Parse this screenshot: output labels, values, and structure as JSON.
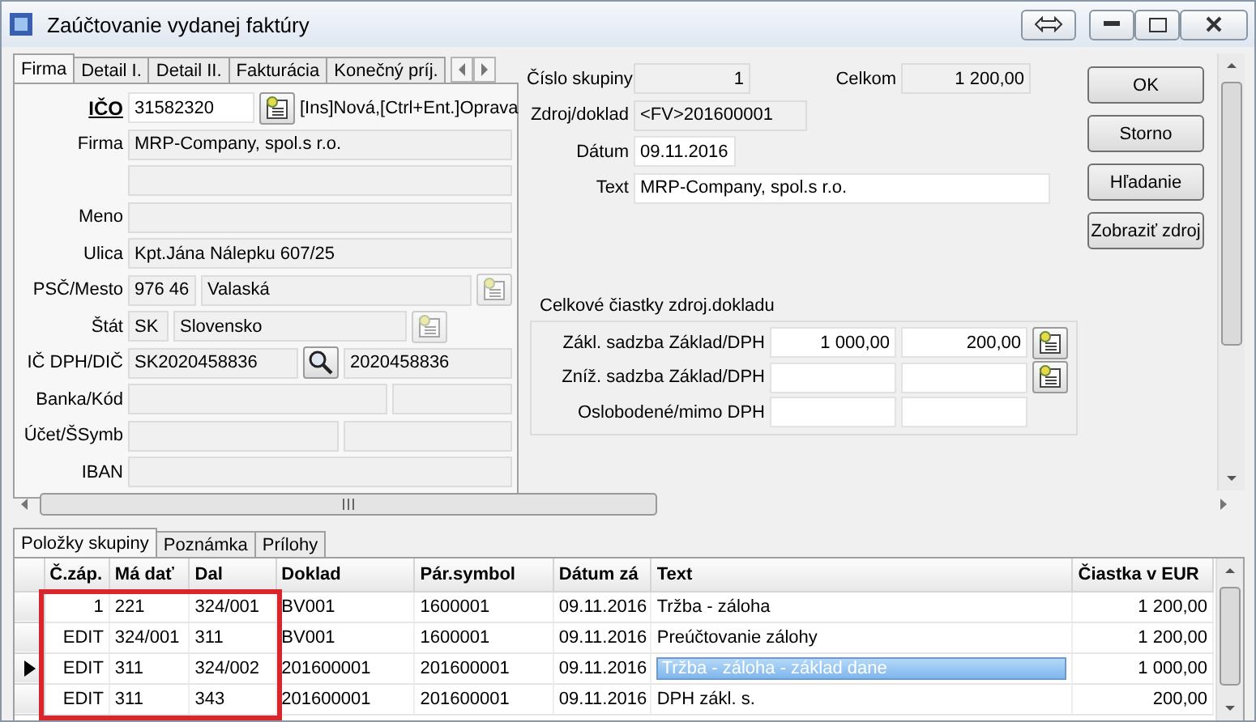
{
  "window": {
    "title": "Zaúčtovanie vydanej faktúry"
  },
  "form_tabs": [
    {
      "label": "Firma",
      "selected": true
    },
    {
      "label": "Detail I.",
      "selected": false
    },
    {
      "label": "Detail II.",
      "selected": false
    },
    {
      "label": "Fakturácia",
      "selected": false
    },
    {
      "label": "Konečný príj.",
      "selected": false
    }
  ],
  "company_rows": [
    {
      "label": "IČO",
      "items": [
        {
          "kind": "field",
          "value": "31582320",
          "editable": true
        },
        {
          "kind": "card-button",
          "disabled": false
        },
        {
          "kind": "hint",
          "text": "[Ins]Nová,[Ctrl+Ent.]Oprava"
        }
      ]
    },
    {
      "label": "Firma",
      "items": [
        {
          "kind": "field",
          "value": "MRP-Company, spol.s r.o.",
          "editable": false
        }
      ]
    },
    {
      "items": [
        {
          "kind": "field",
          "editable": false
        }
      ]
    },
    {
      "label": "Meno",
      "items": [
        {
          "kind": "field",
          "editable": false
        }
      ]
    },
    {
      "label": "Ulica",
      "items": [
        {
          "kind": "field",
          "value": "Kpt.Jána Nálepku 607/25",
          "editable": false
        }
      ]
    },
    {
      "label": "PSČ/Mesto",
      "items": [
        {
          "kind": "field",
          "value": "976 46",
          "editable": false
        },
        {
          "kind": "field",
          "value": "Valaská",
          "editable": false
        },
        {
          "kind": "card-button",
          "disabled": true
        }
      ]
    },
    {
      "label": "Štát",
      "items": [
        {
          "kind": "field",
          "value": "SK",
          "editable": false
        },
        {
          "kind": "field",
          "value": "Slovensko",
          "editable": false
        },
        {
          "kind": "card-button",
          "disabled": true
        }
      ]
    },
    {
      "label": "IČ DPH/DIČ",
      "items": [
        {
          "kind": "field",
          "value": "SK2020458836",
          "editable": false
        },
        {
          "kind": "search-button"
        },
        {
          "kind": "field",
          "value": "2020458836",
          "editable": false
        }
      ]
    },
    {
      "label": "Banka/Kód",
      "items": [
        {
          "kind": "field",
          "editable": false
        },
        {
          "kind": "field",
          "editable": false
        }
      ]
    },
    {
      "label": "Účet/ŠSymb",
      "items": [
        {
          "kind": "field",
          "editable": false
        },
        {
          "kind": "field",
          "editable": false
        }
      ]
    },
    {
      "label": "IBAN",
      "items": [
        {
          "kind": "field",
          "editable": false
        }
      ]
    }
  ],
  "header_fields": [
    {
      "label": "Číslo skupiny",
      "value": "1",
      "editable": false
    },
    {
      "label": "Celkom",
      "value": "1 200,00",
      "editable": false
    },
    {
      "label": "Zdroj/doklad",
      "value": "<FV>201600001",
      "editable": false
    },
    {
      "label": "Dátum",
      "value": "09.11.2016",
      "editable": true
    },
    {
      "label": "Text",
      "value": "MRP-Company, spol.s r.o.",
      "editable": true
    }
  ],
  "buttons": [
    "OK",
    "Storno",
    "Hľadanie",
    "Zobraziť zdroj"
  ],
  "totals": {
    "title": "Celkové čiastky zdroj.dokladu",
    "rows": [
      {
        "label": "Zákl. sadzba Základ/DPH",
        "base": "1 000,00",
        "vat": "200,00",
        "has_button": true
      },
      {
        "label": "Zníž. sadzba Základ/DPH",
        "has_button": true
      },
      {
        "label": "Oslobodené/mimo DPH",
        "has_button": false
      }
    ]
  },
  "bottom_tabs": [
    {
      "label": "Položky skupiny",
      "selected": true
    },
    {
      "label": "Poznámka",
      "selected": false
    },
    {
      "label": "Prílohy",
      "selected": false
    }
  ],
  "table": {
    "annotation_frame": true,
    "columns": [
      {
        "label": "Č.záp."
      },
      {
        "label": "Má dať"
      },
      {
        "label": "Dal"
      },
      {
        "label": "Doklad"
      },
      {
        "label": "Pár.symbol"
      },
      {
        "label": "Dátum zá"
      },
      {
        "label": "Text"
      },
      {
        "label": "Čiastka v EUR"
      }
    ],
    "rows": [
      {
        "selected": false,
        "cells": [
          "1",
          "221",
          "324/001",
          "BV001",
          "1600001",
          "09.11.2016",
          "Tržba - záloha",
          "1 200,00"
        ]
      },
      {
        "selected": false,
        "cells": [
          "EDIT",
          "324/001",
          "311",
          "BV001",
          "1600001",
          "09.11.2016",
          "Preúčtovanie zálohy",
          "1 200,00"
        ]
      },
      {
        "selected": true,
        "cells": [
          "EDIT",
          "311",
          "324/002",
          "201600001",
          "201600001",
          "09.11.2016",
          "Tržba - záloha - základ dane",
          "1 000,00"
        ]
      },
      {
        "selected": false,
        "cells": [
          "EDIT",
          "311",
          "343",
          "201600001",
          "201600001",
          "09.11.2016",
          "DPH zákl. s.",
          "200,00"
        ]
      }
    ]
  }
}
